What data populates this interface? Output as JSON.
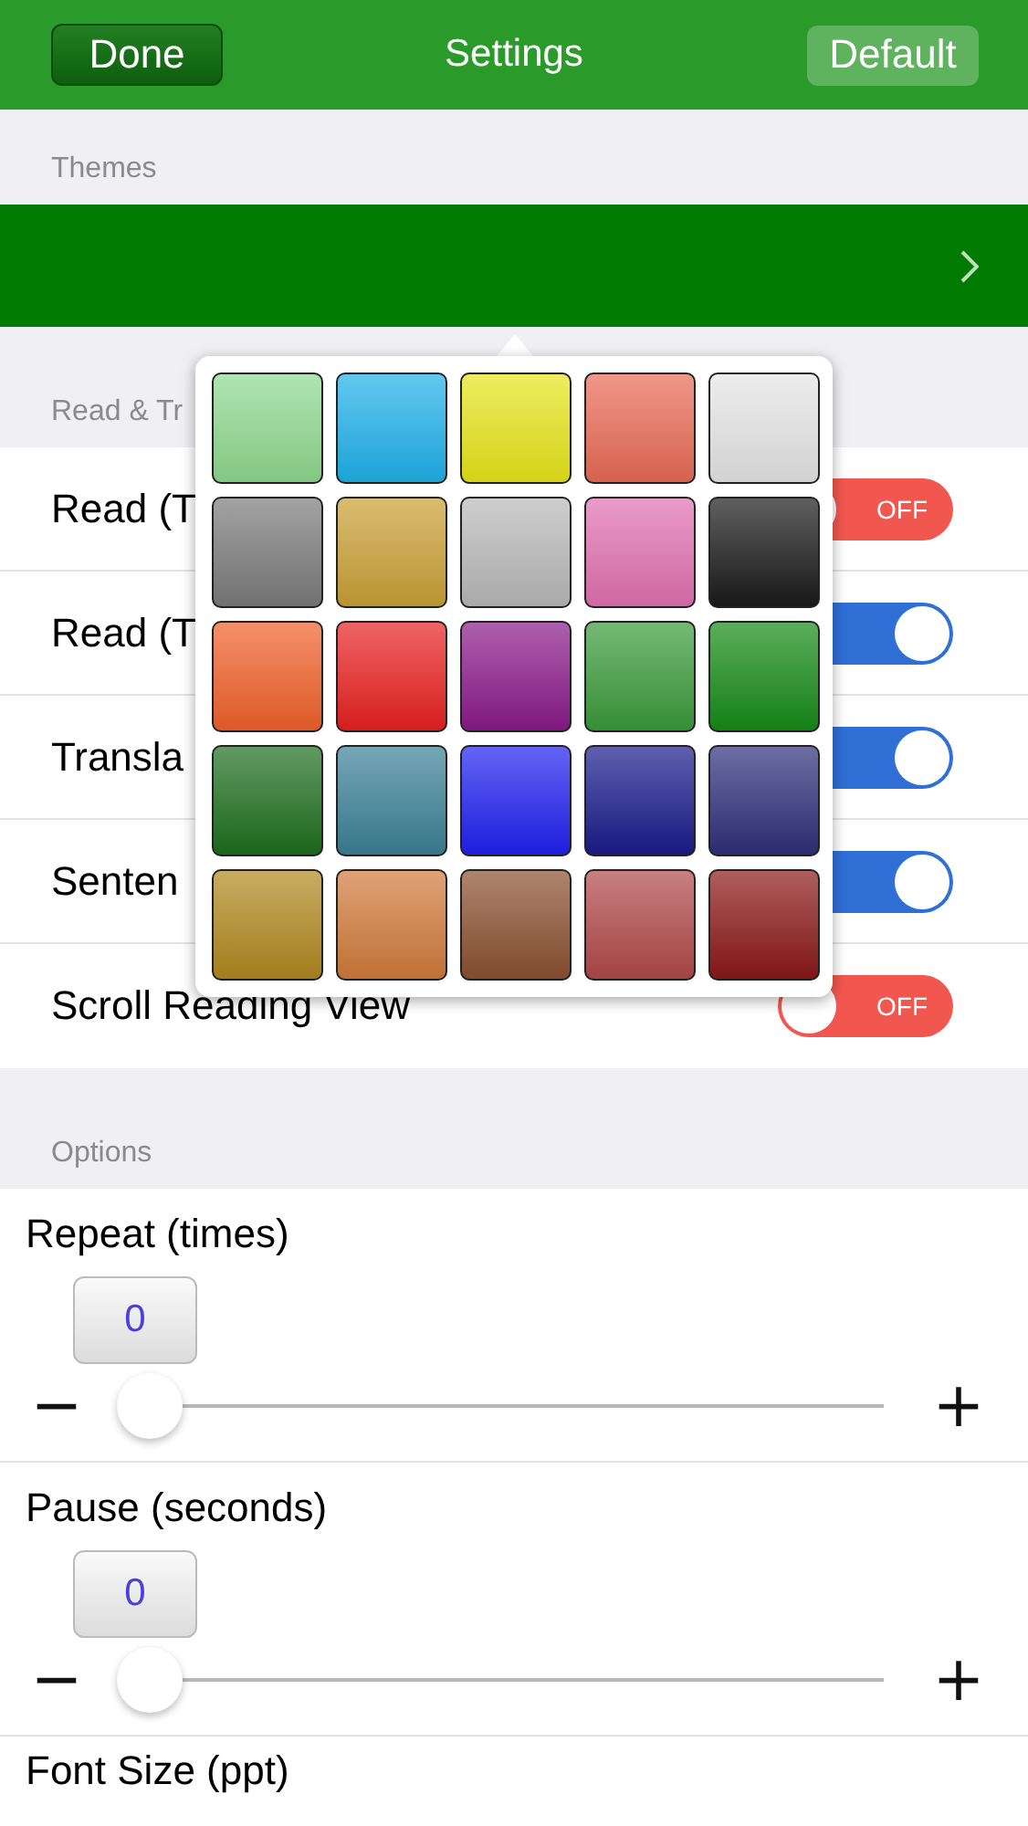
{
  "nav_bar": {
    "left_button": "Done",
    "title": "Settings",
    "right_button": "Default"
  },
  "themes": {
    "header": "Themes"
  },
  "read_section": {
    "header": "Read & Tr",
    "rows": [
      {
        "label": "Read (T",
        "on": false,
        "switch_label": "OFF"
      },
      {
        "label": "Read (T",
        "on": true
      },
      {
        "label": "Transla",
        "on": true
      },
      {
        "label": "Senten",
        "on": true
      },
      {
        "label": "Scroll Reading View",
        "on": false,
        "switch_label": "OFF"
      }
    ]
  },
  "options": {
    "header": "Options",
    "steppers": [
      {
        "title": "Repeat (times)",
        "value": "0",
        "minus": "−",
        "plus": "+",
        "level": 0
      },
      {
        "title": "Pause (seconds)",
        "value": "0",
        "minus": "−",
        "plus": "+",
        "level": 0
      },
      {
        "title": "Font Size (ppt)"
      }
    ]
  },
  "color_picker": {
    "swatches": [
      {
        "color": "#8ed88e"
      },
      {
        "color": "#1fb0e8"
      },
      {
        "color": "#e6e41a"
      },
      {
        "color": "#e86a55"
      },
      {
        "color": "#e4e4e4"
      },
      {
        "color": "#7a7a7a"
      },
      {
        "color": "#c9a035"
      },
      {
        "color": "#b8b8b8"
      },
      {
        "color": "#e070b0"
      },
      {
        "color": "#1a1a1a"
      },
      {
        "color": "#f0602a"
      },
      {
        "color": "#e82020"
      },
      {
        "color": "#8a1a8a"
      },
      {
        "color": "#3a9a3a"
      },
      {
        "color": "#168a16"
      },
      {
        "color": "#1e6e1e"
      },
      {
        "color": "#3a8096"
      },
      {
        "color": "#2020f0"
      },
      {
        "color": "#1a1a8a"
      },
      {
        "color": "#2e2e7a"
      },
      {
        "color": "#b08820"
      },
      {
        "color": "#d07a3a"
      },
      {
        "color": "#8a5030"
      },
      {
        "color": "#b04848"
      },
      {
        "color": "#8a1818"
      }
    ]
  }
}
